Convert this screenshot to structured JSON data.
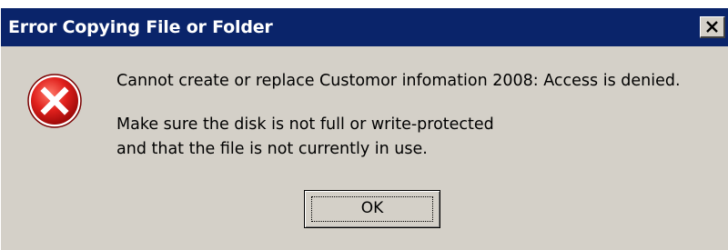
{
  "dialog": {
    "title": "Error Copying File or Folder",
    "icon": "error-icon",
    "close_icon": "close-icon",
    "message_line1": "Cannot create or replace Customor infomation 2008: Access is denied.",
    "message_line2": "Make sure the disk is not full or write-protected",
    "message_line3": "and that the file is not currently in use.",
    "ok_label": "OK"
  },
  "colors": {
    "titlebar": "#0a246a",
    "dialog_bg": "#d4d0c8",
    "error_red": "#d4141c"
  }
}
